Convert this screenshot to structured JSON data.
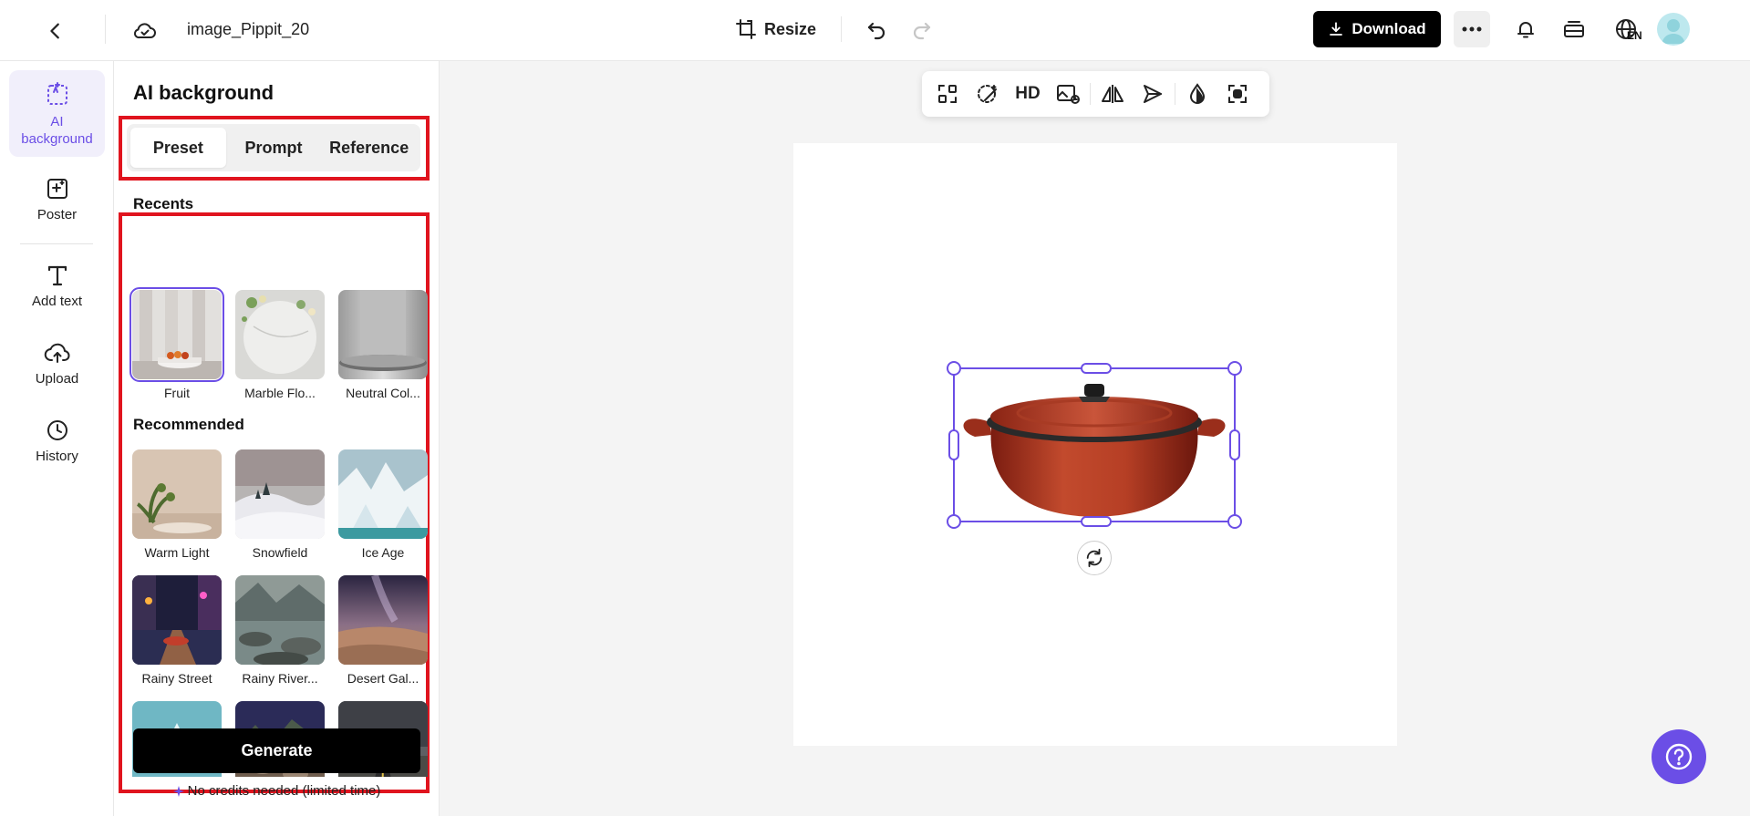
{
  "topbar": {
    "title": "image_Pippit_20",
    "resize_label": "Resize",
    "download_label": "Download",
    "lang_badge": "EN"
  },
  "nav": {
    "items": [
      {
        "label": "AI background",
        "icon": "ai-background-icon",
        "active": true
      },
      {
        "label": "Poster",
        "icon": "poster-icon"
      },
      {
        "label": "Add text",
        "icon": "text-icon"
      },
      {
        "label": "Upload",
        "icon": "upload-icon"
      },
      {
        "label": "History",
        "icon": "history-icon"
      }
    ]
  },
  "panel": {
    "title": "AI background",
    "tabs": [
      "Preset",
      "Prompt",
      "Reference"
    ],
    "active_tab": "Preset",
    "recents_label": "Recents",
    "recents": [
      {
        "label": "Fruit",
        "selected": true
      },
      {
        "label": "Marble Flo..."
      },
      {
        "label": "Neutral Col..."
      }
    ],
    "recommended_label": "Recommended",
    "recommended": [
      {
        "label": "Warm Light"
      },
      {
        "label": "Snowfield"
      },
      {
        "label": "Ice Age"
      },
      {
        "label": "Rainy Street"
      },
      {
        "label": "Rainy River..."
      },
      {
        "label": "Desert Gal..."
      },
      {
        "label": ""
      },
      {
        "label": ""
      },
      {
        "label": ""
      }
    ],
    "generate_label": "Generate",
    "credits_note": "No credits needed (limited time)"
  },
  "floating_toolbar": {
    "hd_label": "HD",
    "tools": [
      "replace-icon",
      "magic-eraser-icon",
      "hd-text",
      "image-adjust-icon",
      "flip-icon",
      "send-icon",
      "opacity-icon",
      "cutout-icon"
    ]
  },
  "colors": {
    "accent": "#6b4ee6",
    "highlight_box": "#e0141e",
    "primary_button": "#000000"
  }
}
